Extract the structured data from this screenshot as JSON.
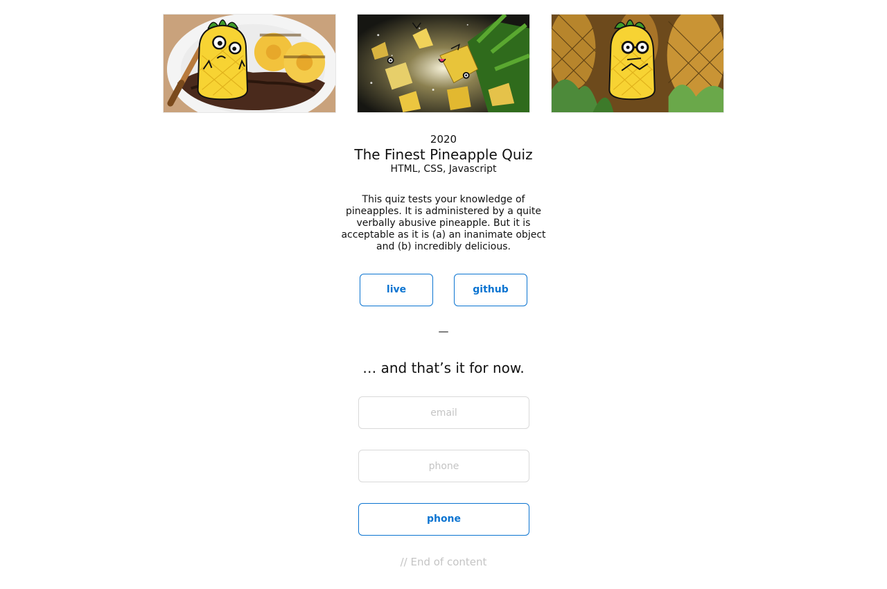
{
  "gallery": [
    {
      "alt": "pineapple with steak",
      "icon": "pineapple-mascot-monocle-icon"
    },
    {
      "alt": "exploding pineapple",
      "icon": "pineapple-mascot-tongue-icon"
    },
    {
      "alt": "pineapples",
      "icon": "pineapple-mascot-glasses-icon"
    }
  ],
  "project": {
    "year": "2020",
    "title": "The Finest Pineapple Quiz",
    "stack": "HTML, CSS, Javascript",
    "description": "This quiz tests your knowledge of pineapples. It is administered by a quite verbally abusive pineapple. But it is acceptable as it is (a) an inanimate object and (b) incredibly delicious.",
    "live_label": "live",
    "github_label": "github"
  },
  "divider": "—",
  "outro": "… and that’s it for now.",
  "contact": {
    "email_placeholder": "email",
    "phone_placeholder": "phone",
    "submit_label": "phone"
  },
  "footer": "// End of content",
  "colors": {
    "accent": "#0b74d1",
    "placeholder": "#c4c4c4",
    "mascot_yellow": "#f7d333",
    "mascot_leaves": "#3f9c2a"
  }
}
